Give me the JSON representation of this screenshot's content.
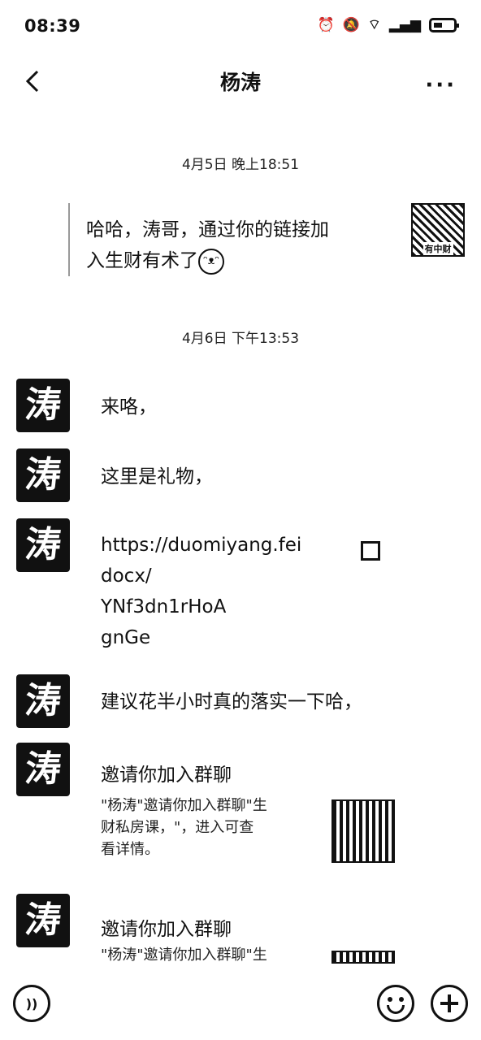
{
  "status_bar": {
    "time": "08:39",
    "icons": [
      "alarm-icon",
      "mute-icon",
      "wifi-icon",
      "signal-icon",
      "battery-icon"
    ]
  },
  "header": {
    "title": "杨涛",
    "back_icon": "chevron-left-icon",
    "more_icon": "more-dots-icon",
    "more_label": "···"
  },
  "messages": {
    "divider_1": "4月5日 晚上18:51",
    "my_message": {
      "line1": "哈哈，涛哥，通过你的链接加",
      "line2": "入生财有术了",
      "emoji": "ᵔᴥᵔ",
      "avatar_label": "有中财"
    },
    "divider_2": "4月6日 下午13:53",
    "avatar_char": "涛",
    "m1": "来咯，",
    "m2": "这里是礼物，",
    "link": {
      "line1": "https://duomiyang.fei",
      "line2": "docx/",
      "line3": "YNf3dn1rHoA",
      "line4": "gnGe"
    },
    "m4": "建议花半小时真的落实一下哈，",
    "card1": {
      "title": "邀请你加入群聊",
      "desc_line1": "\"杨涛\"邀请你加入群聊\"生",
      "desc_line2": "财私房课，\"，进入可查",
      "desc_line3": "看详情。"
    },
    "card2": {
      "title": "邀请你加入群聊",
      "desc_line1": "\"杨涛\"邀请你加入群聊\"生"
    }
  },
  "input_bar": {
    "voice_icon": "voice-icon",
    "voice_glyph": "))",
    "emoji_icon": "emoji-icon",
    "plus_icon": "plus-icon"
  }
}
